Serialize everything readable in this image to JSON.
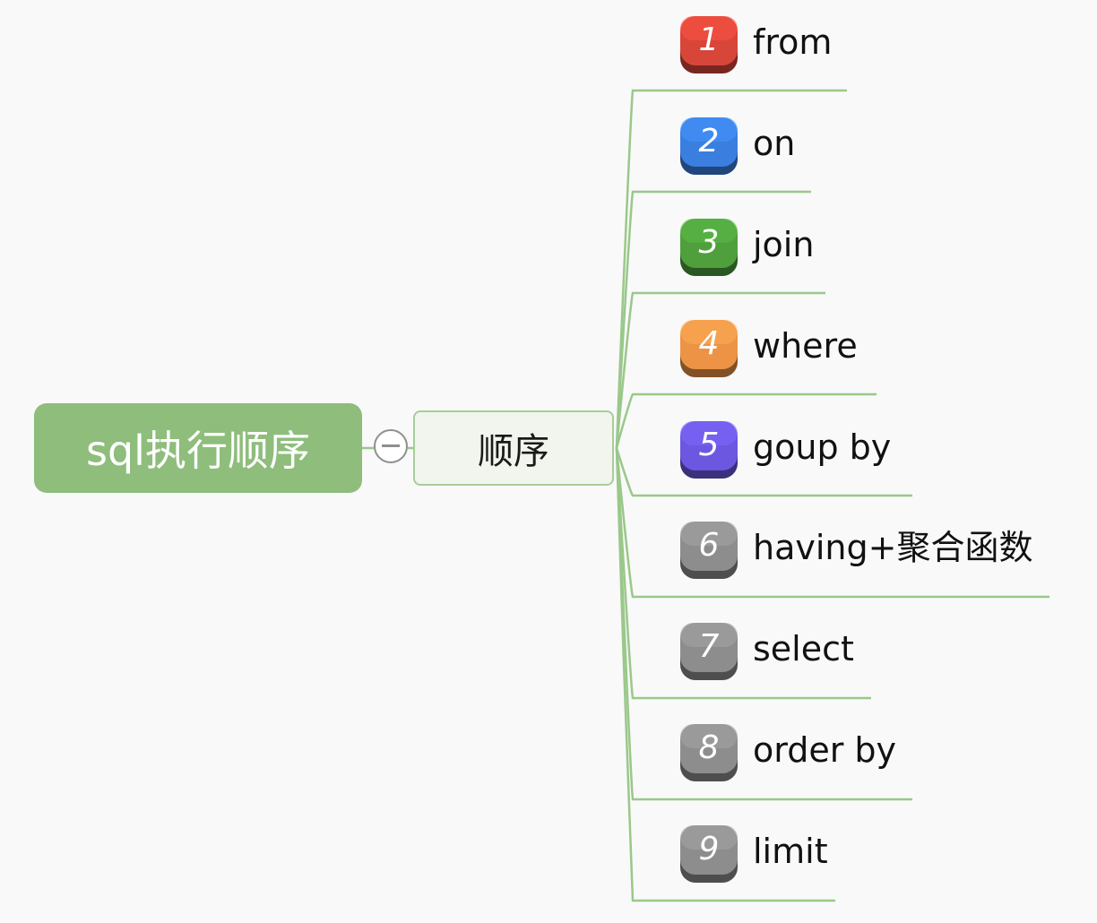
{
  "root": {
    "label": "sql执行顺序"
  },
  "branch": {
    "label": "顺序"
  },
  "items": [
    {
      "num": "1",
      "label": "from",
      "color": "#d8463a"
    },
    {
      "num": "2",
      "label": "on",
      "color": "#3a7fe0"
    },
    {
      "num": "3",
      "label": "join",
      "color": "#4f9f3d"
    },
    {
      "num": "4",
      "label": "where",
      "color": "#ec9346"
    },
    {
      "num": "5",
      "label": "goup by",
      "color": "#6b57e0"
    },
    {
      "num": "6",
      "label": "having+聚合函数",
      "color": "#8d8d8d"
    },
    {
      "num": "7",
      "label": "select",
      "color": "#8d8d8d"
    },
    {
      "num": "8",
      "label": "order by",
      "color": "#8d8d8d"
    },
    {
      "num": "9",
      "label": "limit",
      "color": "#8d8d8d"
    }
  ],
  "colors": {
    "root": "#8ebd7c",
    "connector": "#9ac88a"
  }
}
